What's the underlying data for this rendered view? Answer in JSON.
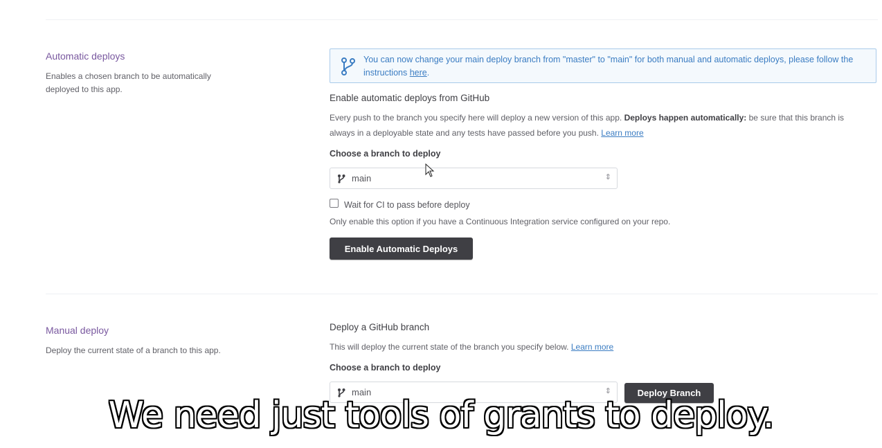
{
  "automatic_section": {
    "title": "Automatic deploys",
    "description": "Enables a chosen branch to be automatically deployed to this app.",
    "notice": {
      "text": "You can now change your main deploy branch from \"master\" to \"main\" for both manual and automatic deploys, please follow the instructions ",
      "link_label": "here",
      "icon": "branch-icon"
    },
    "heading": "Enable automatic deploys from GitHub",
    "body_prefix": "Every push to the branch you specify here will deploy a new version of this app. ",
    "body_bold": "Deploys happen automatically:",
    "body_suffix": " be sure that this branch is always in a deployable state and any tests have passed before you push. ",
    "learn_more": "Learn more",
    "branch_label": "Choose a branch to deploy",
    "branch_value": "main",
    "ci_checkbox_label": "Wait for CI to pass before deploy",
    "ci_checkbox_checked": false,
    "ci_help": "Only enable this option if you have a Continuous Integration service configured on your repo.",
    "button_label": "Enable Automatic Deploys"
  },
  "manual_section": {
    "title": "Manual deploy",
    "description": "Deploy the current state of a branch to this app.",
    "heading": "Deploy a GitHub branch",
    "body": "This will deploy the current state of the branch you specify below. ",
    "learn_more": "Learn more",
    "branch_label": "Choose a branch to deploy",
    "branch_value": "main",
    "button_label": "Deploy Branch"
  },
  "caption": "We need just tools of grants to deploy.",
  "colors": {
    "section_title": "#79589f",
    "link": "#3a7cc2",
    "notice_border": "#a9cbea",
    "button_dark": "#3f3f44"
  }
}
